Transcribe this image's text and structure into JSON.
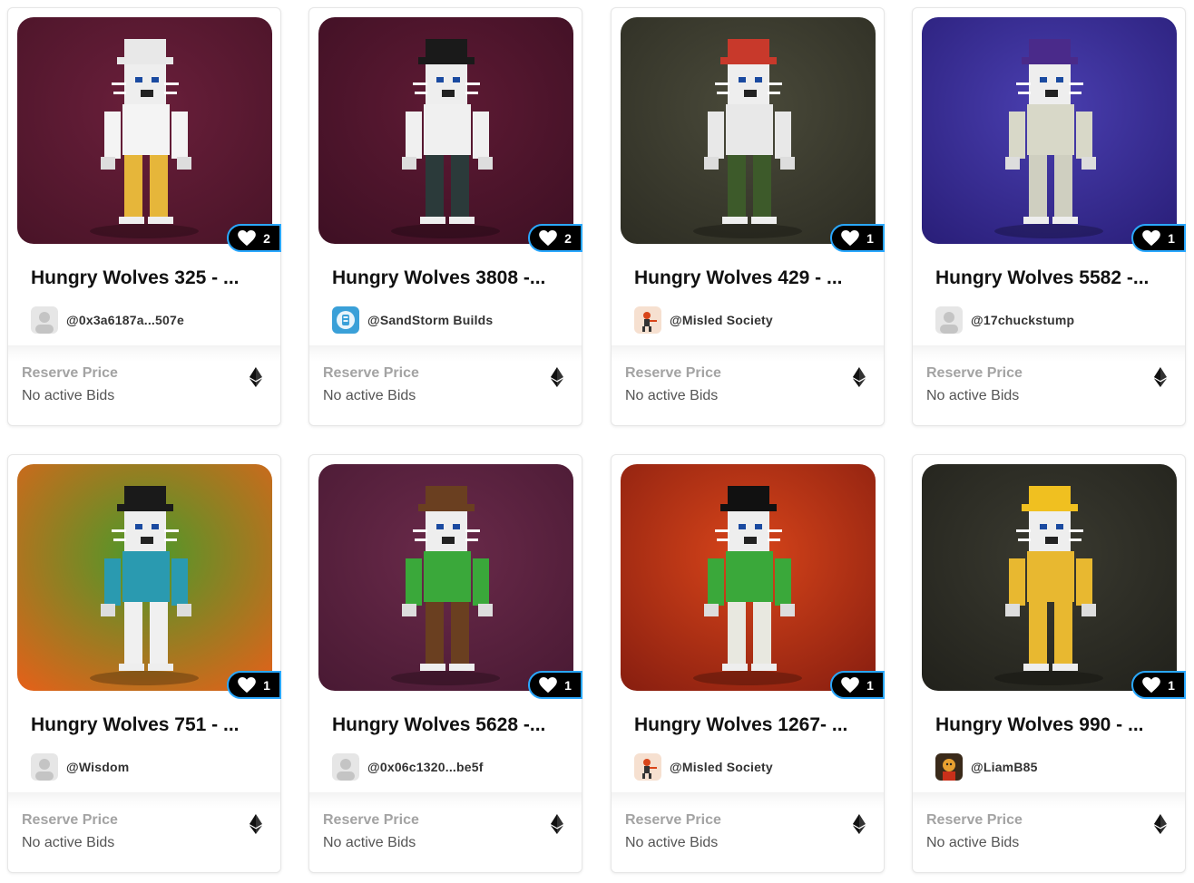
{
  "cards": [
    {
      "title": "Hungry Wolves 325 - ...",
      "creator": "@0x3a6187a...507e",
      "likes": "2",
      "reserve_label": "Reserve Price",
      "bids": "No active Bids",
      "avatar": "default-avatar-icon",
      "bg": [
        "#6a1f3b",
        "#4a1428"
      ],
      "hat": "#e8e8e8",
      "body": "#f4f4f4",
      "legs": "#e6b63a"
    },
    {
      "title": "Hungry Wolves 3808 -...",
      "creator": "@SandStorm Builds",
      "likes": "2",
      "reserve_label": "Reserve Price",
      "bids": "No active Bids",
      "avatar": "sandstorm-avatar-icon",
      "bg": [
        "#5e1a34",
        "#3f1024"
      ],
      "hat": "#1a1a1a",
      "body": "#f0f0f0",
      "legs": "#2b3a3a"
    },
    {
      "title": "Hungry Wolves 429 - ...",
      "creator": "@Misled Society",
      "likes": "1",
      "reserve_label": "Reserve Price",
      "bids": "No active Bids",
      "avatar": "misled-society-avatar-icon",
      "bg": [
        "#4a4a3a",
        "#2e2e24"
      ],
      "hat": "#c8392b",
      "body": "#e8e8e8",
      "legs": "#3d5a2a"
    },
    {
      "title": "Hungry Wolves 5582 -...",
      "creator": "@17chuckstump",
      "likes": "1",
      "reserve_label": "Reserve Price",
      "bids": "No active Bids",
      "avatar": "default-avatar-icon",
      "bg": [
        "#4a3fb0",
        "#2a1f7a"
      ],
      "hat": "#4a2a8a",
      "body": "#d8d8c8",
      "legs": "#cfcfc0"
    },
    {
      "title": "Hungry Wolves 751 - ...",
      "creator": "@Wisdom",
      "likes": "1",
      "reserve_label": "Reserve Price",
      "bids": "No active Bids",
      "avatar": "default-avatar-icon",
      "bg": [
        "#4a9a2a",
        "#e0621a"
      ],
      "hat": "#1a1a1a",
      "body": "#2a9ab0",
      "legs": "#f0f0f0"
    },
    {
      "title": "Hungry Wolves 5628 -...",
      "creator": "@0x06c1320...be5f",
      "likes": "1",
      "reserve_label": "Reserve Price",
      "bids": "No active Bids",
      "avatar": "default-avatar-icon",
      "bg": [
        "#6a2a4a",
        "#4a1a34"
      ],
      "hat": "#6a3f20",
      "body": "#3aa83a",
      "legs": "#6a3f20"
    },
    {
      "title": "Hungry Wolves 1267- ...",
      "creator": "@Misled Society",
      "likes": "1",
      "reserve_label": "Reserve Price",
      "bids": "No active Bids",
      "avatar": "misled-society-avatar-icon",
      "bg": [
        "#d8451a",
        "#8a1f10"
      ],
      "hat": "#111111",
      "body": "#3aa83a",
      "legs": "#e8e8e0"
    },
    {
      "title": "Hungry Wolves 990 - ...",
      "creator": "@LiamB85",
      "likes": "1",
      "reserve_label": "Reserve Price",
      "bids": "No active Bids",
      "avatar": "liamb85-avatar-icon",
      "bg": [
        "#3a3a30",
        "#22221c"
      ],
      "hat": "#f0c020",
      "body": "#e8b830",
      "legs": "#e8b830"
    }
  ],
  "colors": {
    "like_border": "#2aa8ff",
    "like_bg": "#000000",
    "reserve_label": "#a3a3a3",
    "bids_text": "#555555"
  }
}
